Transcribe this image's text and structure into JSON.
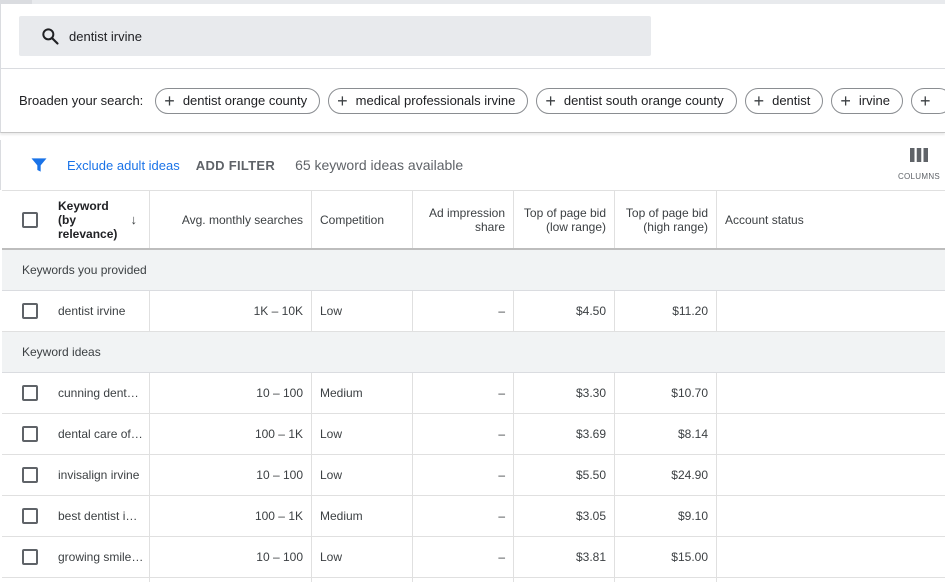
{
  "search": {
    "query": "dentist irvine"
  },
  "broaden": {
    "label": "Broaden your search:",
    "chips": [
      "dentist orange county",
      "medical professionals irvine",
      "dentist south orange county",
      "dentist",
      "irvine",
      ""
    ]
  },
  "filters": {
    "exclude_label": "Exclude adult ideas",
    "add_filter_label": "ADD FILTER",
    "count_label": "65 keyword ideas available",
    "columns_label": "COLUMNS"
  },
  "table": {
    "headers": {
      "keyword": "Keyword (by relevance)",
      "avg": "Avg. monthly searches",
      "competition": "Competition",
      "impression": "Ad impression share",
      "low": "Top of page bid (low range)",
      "high": "Top of page bid (high range)",
      "account": "Account status"
    },
    "sections": [
      {
        "title": "Keywords you provided",
        "rows": [
          {
            "keyword": "dentist irvine",
            "avg": "1K – 10K",
            "competition": "Low",
            "impression": "–",
            "low": "$4.50",
            "high": "$11.20"
          }
        ]
      },
      {
        "title": "Keyword ideas",
        "rows": [
          {
            "keyword": "cunning dental irvine",
            "avg": "10 – 100",
            "competition": "Medium",
            "impression": "–",
            "low": "$3.30",
            "high": "$10.70"
          },
          {
            "keyword": "dental care of irvine",
            "avg": "100 – 1K",
            "competition": "Low",
            "impression": "–",
            "low": "$3.69",
            "high": "$8.14"
          },
          {
            "keyword": "invisalign irvine",
            "avg": "10 – 100",
            "competition": "Low",
            "impression": "–",
            "low": "$5.50",
            "high": "$24.90"
          },
          {
            "keyword": "best dentist in irvine",
            "avg": "100 – 1K",
            "competition": "Medium",
            "impression": "–",
            "low": "$3.05",
            "high": "$9.10"
          },
          {
            "keyword": "growing smiles irvine",
            "avg": "10 – 100",
            "competition": "Low",
            "impression": "–",
            "low": "$3.81",
            "high": "$15.00"
          }
        ]
      }
    ]
  },
  "icons": {
    "search": "search-icon",
    "filter": "filter-icon",
    "columns": "columns-icon",
    "sort": "arrow-down-icon",
    "add": "plus-icon"
  },
  "colors": {
    "link": "#1a73e8",
    "searchBg": "#e8eaed",
    "sectionBg": "#f1f3f4"
  }
}
